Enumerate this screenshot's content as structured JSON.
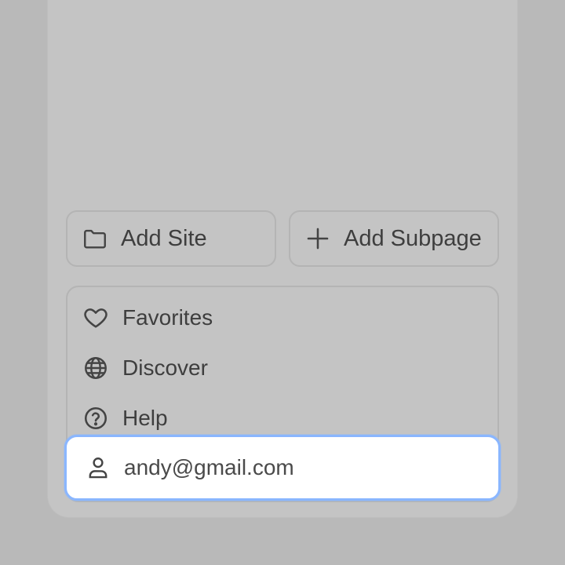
{
  "actions": {
    "add_site_label": "Add Site",
    "add_subpage_label": "Add Subpage"
  },
  "menu": {
    "items": [
      {
        "label": "Favorites",
        "icon": "heart-icon"
      },
      {
        "label": "Discover",
        "icon": "globe-icon"
      },
      {
        "label": "Help",
        "icon": "help-circle-icon"
      }
    ]
  },
  "account": {
    "email": "andy@gmail.com",
    "icon": "user-icon",
    "highlight_color": "#8ab6ff"
  },
  "colors": {
    "background": "#b9b9b9",
    "panel": "#c4c4c4",
    "text": "#3e3e3e"
  }
}
